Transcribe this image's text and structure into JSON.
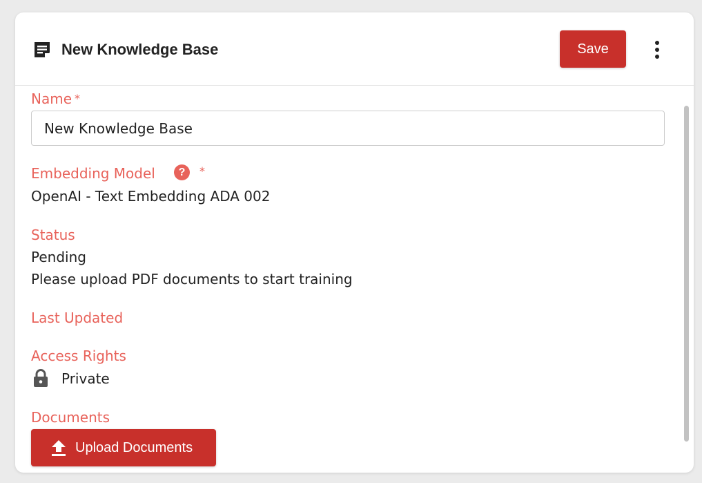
{
  "header": {
    "title": "New Knowledge Base",
    "save_label": "Save",
    "doc_icon": "document-note-icon",
    "more_icon": "more-vertical-icon"
  },
  "form": {
    "name_label": "Name",
    "required_mark": "*",
    "name_value": "New Knowledge Base",
    "embedding_label": "Embedding Model",
    "embedding_help_glyph": "?",
    "embedding_value": "OpenAI - Text Embedding ADA 002",
    "status_label": "Status",
    "status_value": "Pending",
    "status_message": "Please upload PDF documents to start training",
    "last_updated_label": "Last Updated",
    "access_label": "Access Rights",
    "access_value": "Private",
    "documents_label": "Documents",
    "upload_label": "Upload Documents"
  },
  "colors": {
    "accent": "#c8302b",
    "label": "#e8625a",
    "text": "#222222"
  }
}
